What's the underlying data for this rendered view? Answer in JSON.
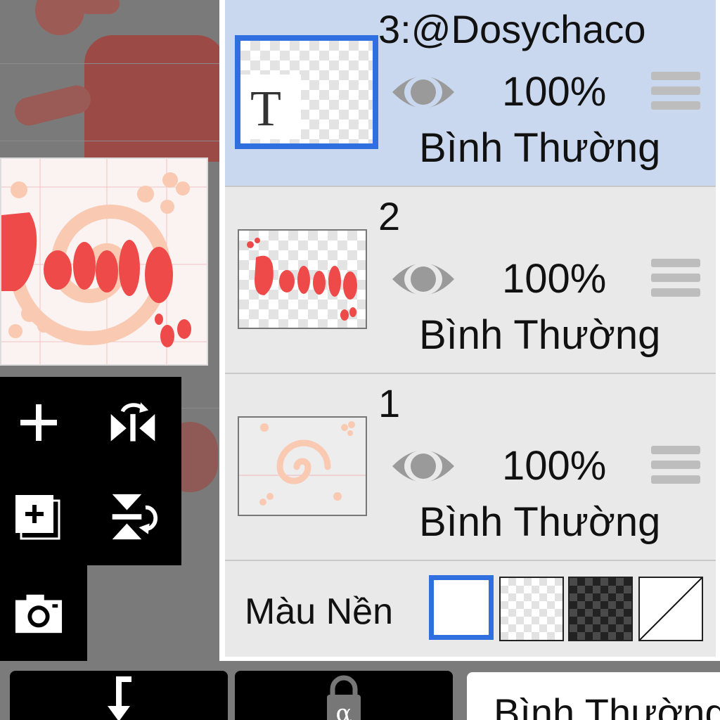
{
  "layers": [
    {
      "name": "3:@Dosychaco",
      "opacity": "100%",
      "blend_mode": "Bình Thường",
      "selected": true,
      "thumb_text": "T"
    },
    {
      "name": "2",
      "opacity": "100%",
      "blend_mode": "Bình Thường",
      "selected": false
    },
    {
      "name": "1",
      "opacity": "100%",
      "blend_mode": "Bình Thường",
      "selected": false
    }
  ],
  "background_color": {
    "label": "Màu Nền",
    "options": [
      "white",
      "transparent-light",
      "transparent-dark",
      "none"
    ],
    "selected": "white"
  },
  "bottom_bar": {
    "blend_mode_value": "Bình Thường",
    "alpha_lock_symbol": "α"
  },
  "colors": {
    "accent": "#2f6fe0",
    "selected_row": "#c9d8ef",
    "panel_bg": "#e9e9e9",
    "text": "#111111",
    "artwork_red": "#ee4a4a",
    "artwork_peach": "#f9c9b1"
  },
  "icons": {
    "layer_visible": "eye-icon",
    "reorder": "drag-handle-icon",
    "add_layer": "plus-icon",
    "duplicate_layer": "duplicate-layer-icon",
    "flip_horizontal": "flip-horizontal-icon",
    "flip_vertical": "flip-vertical-icon",
    "camera": "camera-icon",
    "merge_down": "merge-down-arrow-icon",
    "alpha_lock": "alpha-lock-icon"
  }
}
